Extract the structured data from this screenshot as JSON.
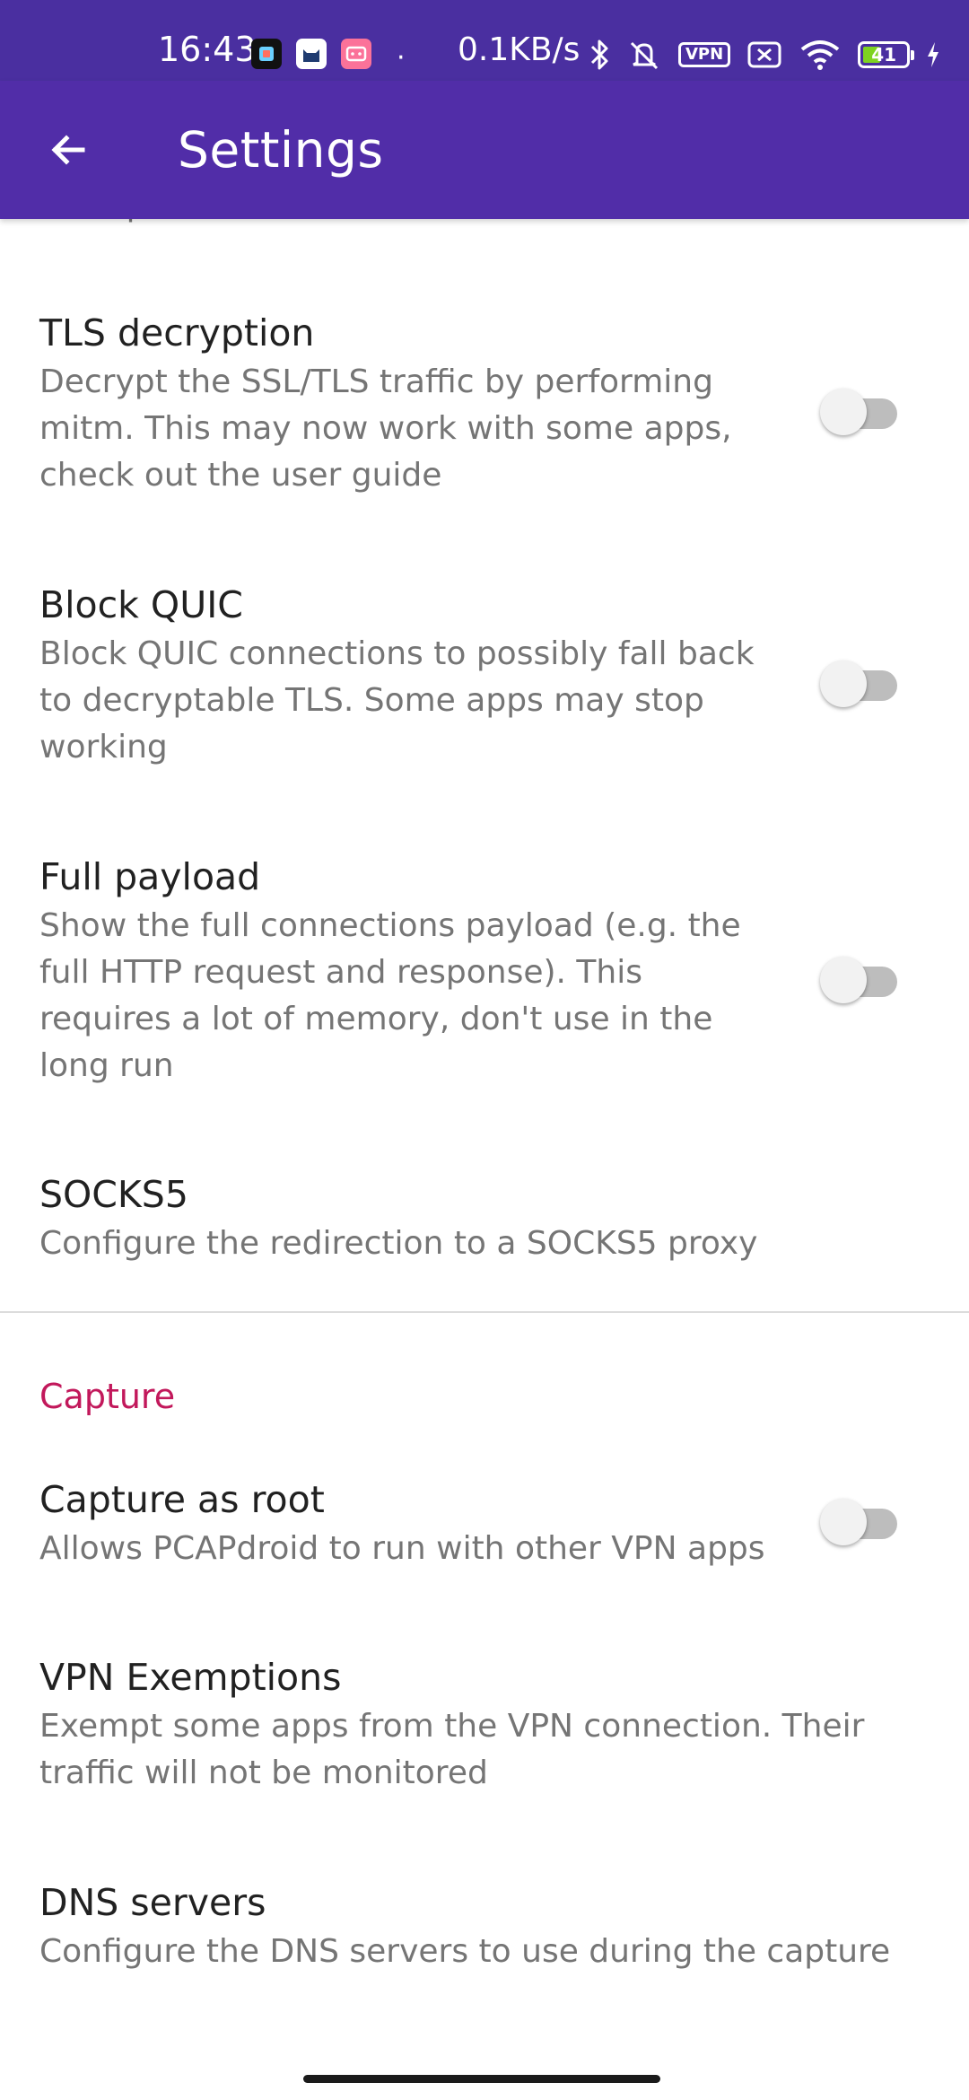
{
  "status_bar": {
    "time": "16:43",
    "net_speed": "0.1KB/s",
    "vpn_label": "VPN",
    "battery_level": "41",
    "battery_fraction": 0.41,
    "icons": [
      "bluetooth-icon",
      "mute-icon",
      "vpn-icon",
      "no-sim-icon",
      "wifi-icon",
      "battery-icon",
      "charging-icon"
    ],
    "notification_dot": "·"
  },
  "app_bar": {
    "title": "Settings",
    "back_icon": "arrow-back-icon",
    "background": "#512da8"
  },
  "colors": {
    "category": "#c2185b",
    "switch_off_track": "#bdbdbd",
    "switch_off_thumb": "#f2f2f2"
  },
  "top_cut_text": "lookups",
  "preferences": [
    {
      "title": "TLS decryption",
      "summary": "Decrypt the SSL/TLS traffic by performing mitm. This may now work with some apps, check out the user guide",
      "switch_on": false
    },
    {
      "title": "Block QUIC",
      "summary": "Block QUIC connections to possibly fall back to decryptable TLS. Some apps may stop working",
      "switch_on": false
    },
    {
      "title": "Full payload",
      "summary": "Show the full connections payload (e.g. the full HTTP request and response). This requires a lot of memory, don't use in the long run",
      "switch_on": false
    },
    {
      "title": "SOCKS5",
      "summary": "Configure the redirection to a SOCKS5 proxy"
    }
  ],
  "capture_category": {
    "title": "Capture",
    "items": [
      {
        "title": "Capture as root",
        "summary": "Allows PCAPdroid to run with other VPN apps",
        "switch_on": false
      },
      {
        "title": "VPN Exemptions",
        "summary": "Exempt some apps from the VPN connection. Their traffic will not be monitored"
      },
      {
        "title": "DNS servers",
        "summary": "Configure the DNS servers to use during the capture"
      }
    ]
  }
}
